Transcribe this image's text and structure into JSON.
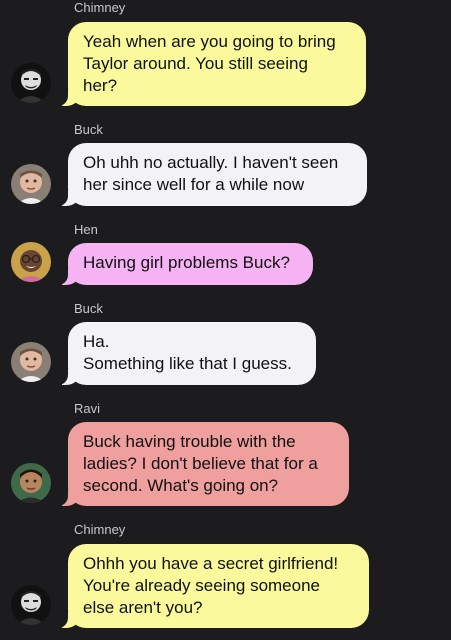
{
  "colors": {
    "background": "#1c1c1e",
    "chimney_bubble": "#fafa9c",
    "buck_bubble": "#f2f2f7",
    "hen_bubble": "#f5b3f3",
    "ravi_bubble": "#ef9f9d"
  },
  "messages": [
    {
      "sender": "Chimney",
      "text": "Yeah when are you going to bring\nTaylor around. You still seeing\nher?"
    },
    {
      "sender": "Buck",
      "text": "Oh uhh no actually. I haven't seen\nher since well for a while now"
    },
    {
      "sender": "Hen",
      "text": "Having girl problems Buck?"
    },
    {
      "sender": "Buck",
      "text": "Ha.\nSomething like that I guess."
    },
    {
      "sender": "Ravi",
      "text": "Buck having trouble with the\nladies? I don't believe that for a\nsecond. What's going on?"
    },
    {
      "sender": "Chimney",
      "text": "Ohhh you have a secret girlfriend!\nYou're already seeing someone\nelse aren't you?"
    }
  ]
}
